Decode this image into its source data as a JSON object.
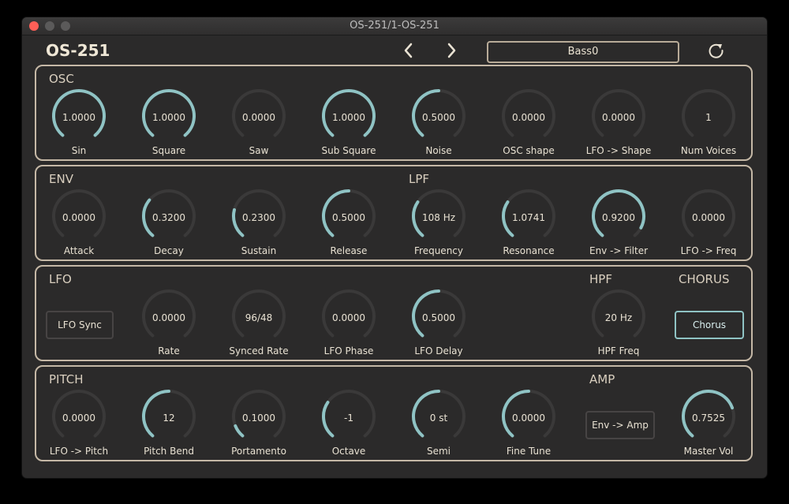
{
  "window": {
    "title": "OS-251/1-OS-251"
  },
  "header": {
    "app_title": "OS-251",
    "preset_name": "Bass0"
  },
  "colors": {
    "accent": "#8fc3c4",
    "track": "#3a3939",
    "panel_border": "#c5b8a6",
    "background": "#2b2a2a"
  },
  "sections": {
    "osc": "OSC",
    "env": "ENV",
    "lpf": "LPF",
    "lfo": "LFO",
    "hpf": "HPF",
    "chorus": "CHORUS",
    "pitch": "PITCH",
    "amp": "AMP"
  },
  "buttons": {
    "lfo_sync": "LFO Sync",
    "chorus": "Chorus",
    "env_amp": "Env -> Amp"
  },
  "knobs": {
    "sin": {
      "label": "Sin",
      "value": "1.0000",
      "level": 1.0
    },
    "square": {
      "label": "Square",
      "value": "1.0000",
      "level": 1.0
    },
    "saw": {
      "label": "Saw",
      "value": "0.0000",
      "level": 0.0
    },
    "sub_square": {
      "label": "Sub Square",
      "value": "1.0000",
      "level": 1.0
    },
    "noise": {
      "label": "Noise",
      "value": "0.5000",
      "level": 0.5
    },
    "osc_shape": {
      "label": "OSC shape",
      "value": "0.0000",
      "level": 0.0
    },
    "lfo_shape": {
      "label": "LFO -> Shape",
      "value": "0.0000",
      "level": 0.0
    },
    "num_voices": {
      "label": "Num Voices",
      "value": "1",
      "level": 0.0
    },
    "attack": {
      "label": "Attack",
      "value": "0.0000",
      "level": 0.0
    },
    "decay": {
      "label": "Decay",
      "value": "0.3200",
      "level": 0.32
    },
    "sustain": {
      "label": "Sustain",
      "value": "0.2300",
      "level": 0.23
    },
    "release": {
      "label": "Release",
      "value": "0.5000",
      "level": 0.5
    },
    "frequency": {
      "label": "Frequency",
      "value": "108 Hz",
      "level": 0.3
    },
    "resonance": {
      "label": "Resonance",
      "value": "1.0741",
      "level": 0.3
    },
    "env_filter": {
      "label": "Env -> Filter",
      "value": "0.9200",
      "level": 0.92
    },
    "lfo_freq": {
      "label": "LFO -> Freq",
      "value": "0.0000",
      "level": 0.0
    },
    "rate": {
      "label": "Rate",
      "value": "0.0000",
      "level": 0.0
    },
    "synced_rate": {
      "label": "Synced Rate",
      "value": "96/48",
      "level": 0.0
    },
    "lfo_phase": {
      "label": "LFO Phase",
      "value": "0.0000",
      "level": 0.0
    },
    "lfo_delay": {
      "label": "LFO Delay",
      "value": "0.5000",
      "level": 0.5
    },
    "hpf_freq": {
      "label": "HPF Freq",
      "value": "20 Hz",
      "level": 0.0
    },
    "lfo_pitch": {
      "label": "LFO -> Pitch",
      "value": "0.0000",
      "level": 0.0
    },
    "pitch_bend": {
      "label": "Pitch Bend",
      "value": "12",
      "level": 0.5
    },
    "portamento": {
      "label": "Portamento",
      "value": "0.1000",
      "level": 0.1
    },
    "octave": {
      "label": "Octave",
      "value": "-1",
      "level": 0.3
    },
    "semi": {
      "label": "Semi",
      "value": "0 st",
      "level": 0.5
    },
    "fine_tune": {
      "label": "Fine Tune",
      "value": "0.0000",
      "level": 0.5
    },
    "master_vol": {
      "label": "Master Vol",
      "value": "0.7525",
      "level": 0.75
    }
  }
}
